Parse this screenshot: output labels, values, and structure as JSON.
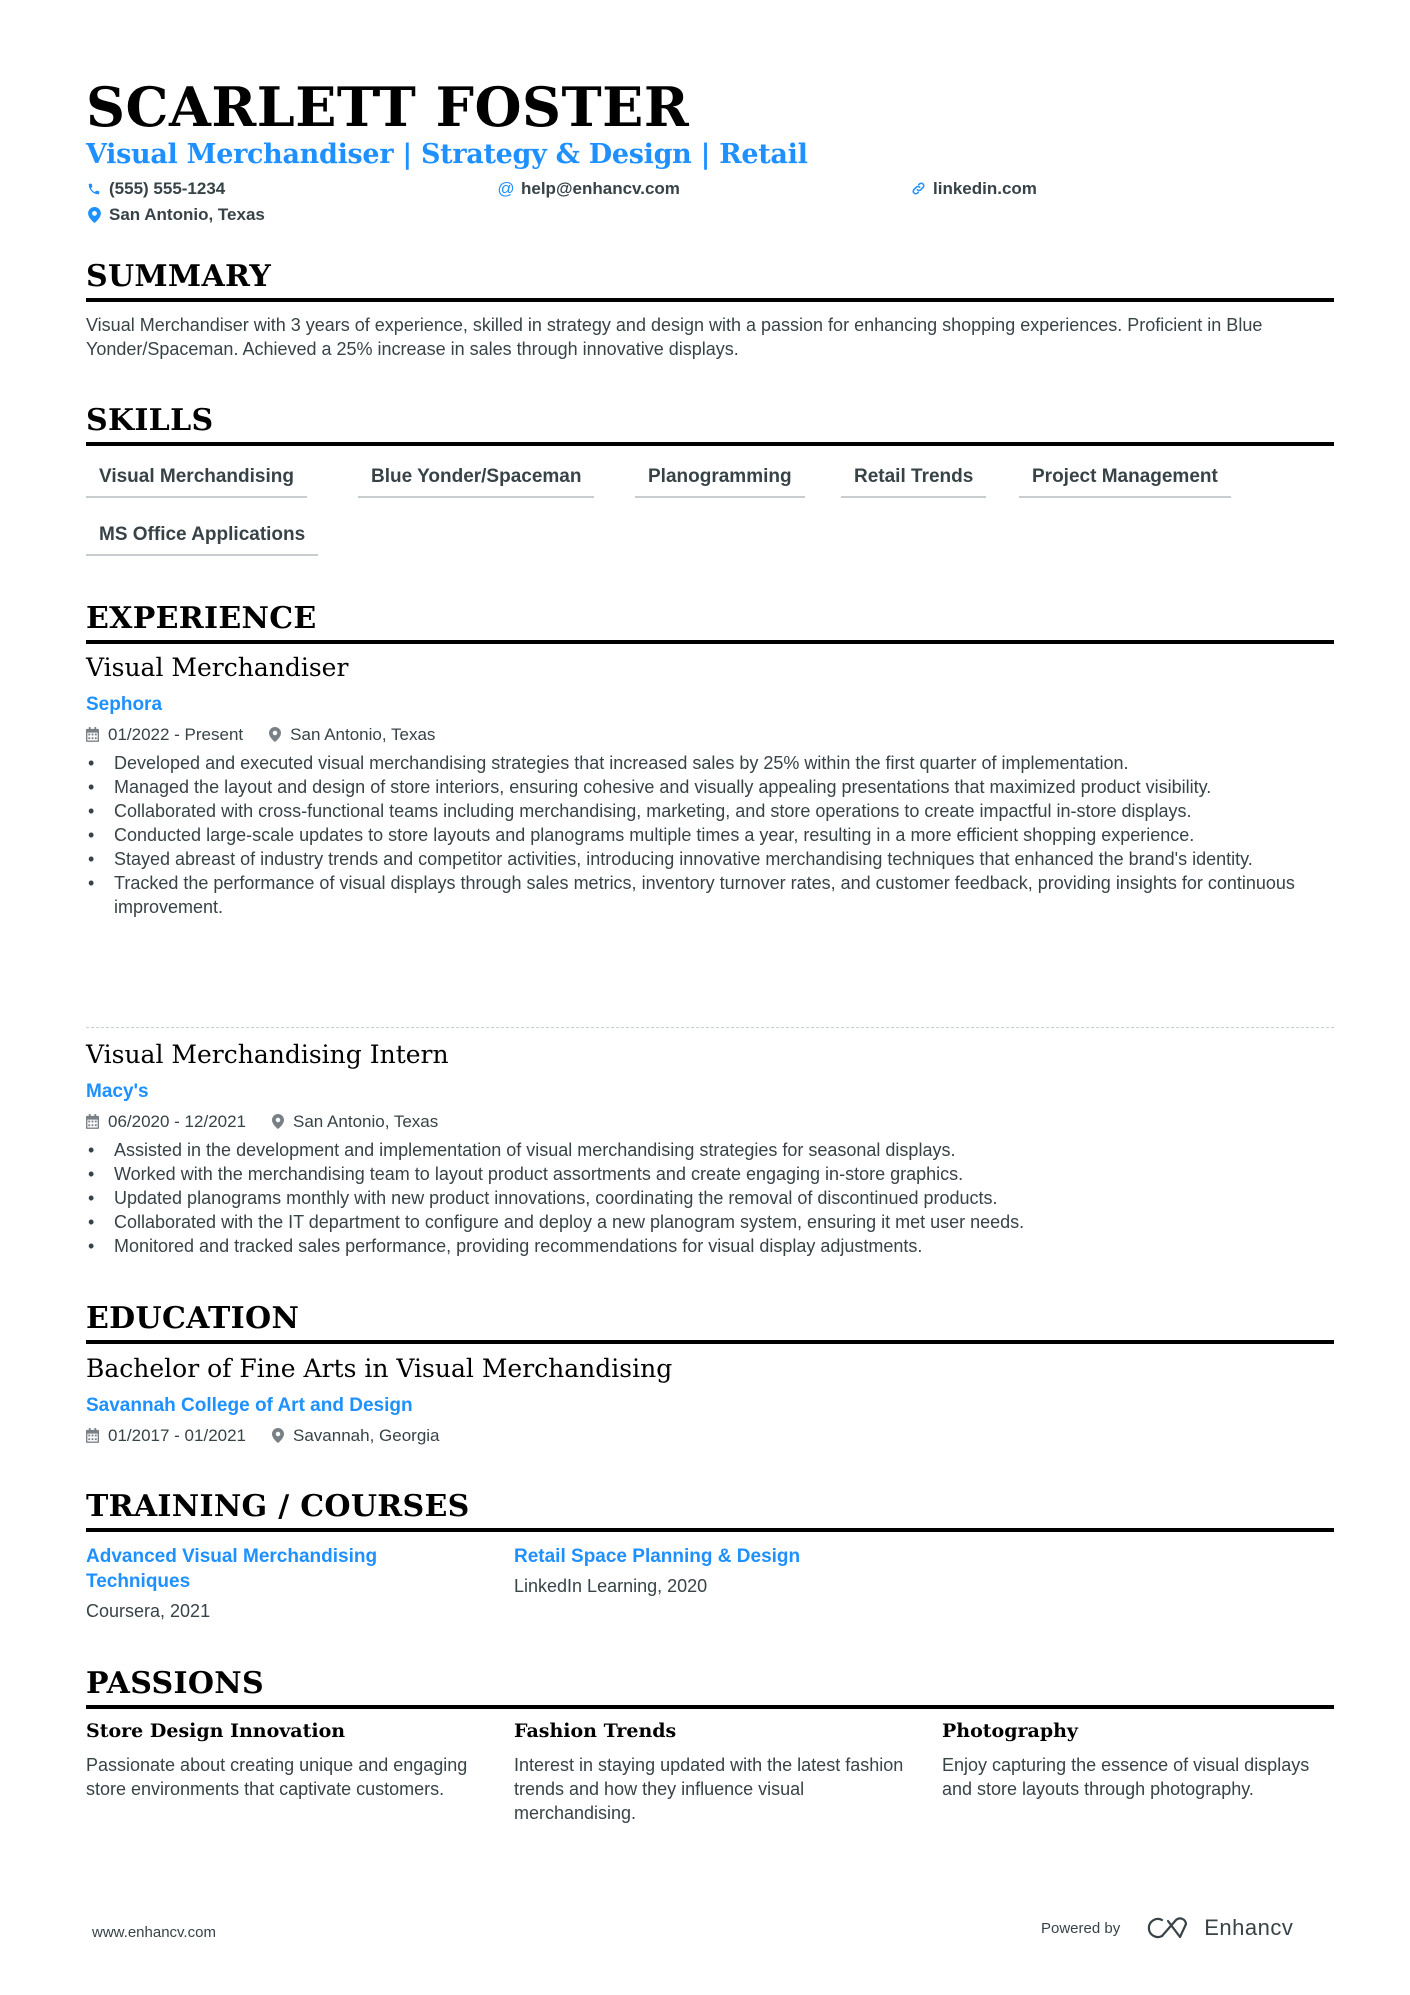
{
  "header": {
    "name": "SCARLETT FOSTER",
    "title": "Visual Merchandiser | Strategy & Design | Retail",
    "contacts": {
      "phone": "(555) 555-1234",
      "email": "help@enhancv.com",
      "linkedin": "linkedin.com",
      "location": "San Antonio, Texas"
    }
  },
  "summary": {
    "heading": "SUMMARY",
    "text": "Visual Merchandiser with 3 years of experience, skilled in strategy and design with a passion for enhancing shopping experiences. Proficient in Blue Yonder/Spaceman. Achieved a 25% increase in sales through innovative displays."
  },
  "skills": {
    "heading": "SKILLS",
    "items": [
      "Visual Merchandising",
      "Blue Yonder/Spaceman",
      "Planogramming",
      "Retail Trends",
      "Project Management",
      "MS Office Applications"
    ]
  },
  "experience": {
    "heading": "EXPERIENCE",
    "jobs": [
      {
        "title": "Visual Merchandiser",
        "company": "Sephora",
        "dates": "01/2022 - Present",
        "location": "San Antonio, Texas",
        "bullets": [
          "Developed and executed visual merchandising strategies that increased sales by 25% within the first quarter of implementation.",
          "Managed the layout and design of store interiors, ensuring cohesive and visually appealing presentations that maximized product visibility.",
          "Collaborated with cross-functional teams including merchandising, marketing, and store operations to create impactful in-store displays.",
          "Conducted large-scale updates to store layouts and planograms multiple times a year, resulting in a more efficient shopping experience.",
          "Stayed abreast of industry trends and competitor activities, introducing innovative merchandising techniques that enhanced the brand's identity.",
          "Tracked the performance of visual displays through sales metrics, inventory turnover rates, and customer feedback, providing insights for continuous improvement."
        ]
      },
      {
        "title": "Visual Merchandising Intern",
        "company": "Macy's",
        "dates": "06/2020 - 12/2021",
        "location": "San Antonio, Texas",
        "bullets": [
          "Assisted in the development and implementation of visual merchandising strategies for seasonal displays.",
          "Worked with the merchandising team to layout product assortments and create engaging in-store graphics.",
          "Updated planograms monthly with new product innovations, coordinating the removal of discontinued products.",
          "Collaborated with the IT department to configure and deploy a new planogram system, ensuring it met user needs.",
          "Monitored and tracked sales performance, providing recommendations for visual display adjustments."
        ]
      }
    ]
  },
  "education": {
    "heading": "EDUCATION",
    "degree": "Bachelor of Fine Arts in Visual Merchandising",
    "school": "Savannah College of Art and Design",
    "dates": "01/2017 - 01/2021",
    "location": "Savannah, Georgia"
  },
  "training": {
    "heading": "TRAINING / COURSES",
    "items": [
      {
        "title": "Advanced Visual Merchandising Techniques",
        "source": "Coursera, 2021"
      },
      {
        "title": "Retail Space Planning & Design",
        "source": "LinkedIn Learning, 2020"
      }
    ]
  },
  "passions": {
    "heading": "PASSIONS",
    "items": [
      {
        "title": "Store Design Innovation",
        "desc": "Passionate about creating unique and engaging store environments that captivate customers."
      },
      {
        "title": "Fashion Trends",
        "desc": "Interest in staying updated with the latest fashion trends and how they influence visual merchandising."
      },
      {
        "title": "Photography",
        "desc": "Enjoy capturing the essence of visual displays and store layouts through photography."
      }
    ]
  },
  "footer": {
    "website": "www.enhancv.com",
    "powered_by": "Powered by",
    "brand": "Enhancv"
  },
  "colors": {
    "accent": "#1e90ff",
    "text": "#384347",
    "heading": "#000000"
  },
  "icons": {
    "phone": "phone-icon",
    "email": "at-icon",
    "linkedin": "link-icon",
    "location": "map-pin-icon",
    "date": "calendar-icon"
  }
}
